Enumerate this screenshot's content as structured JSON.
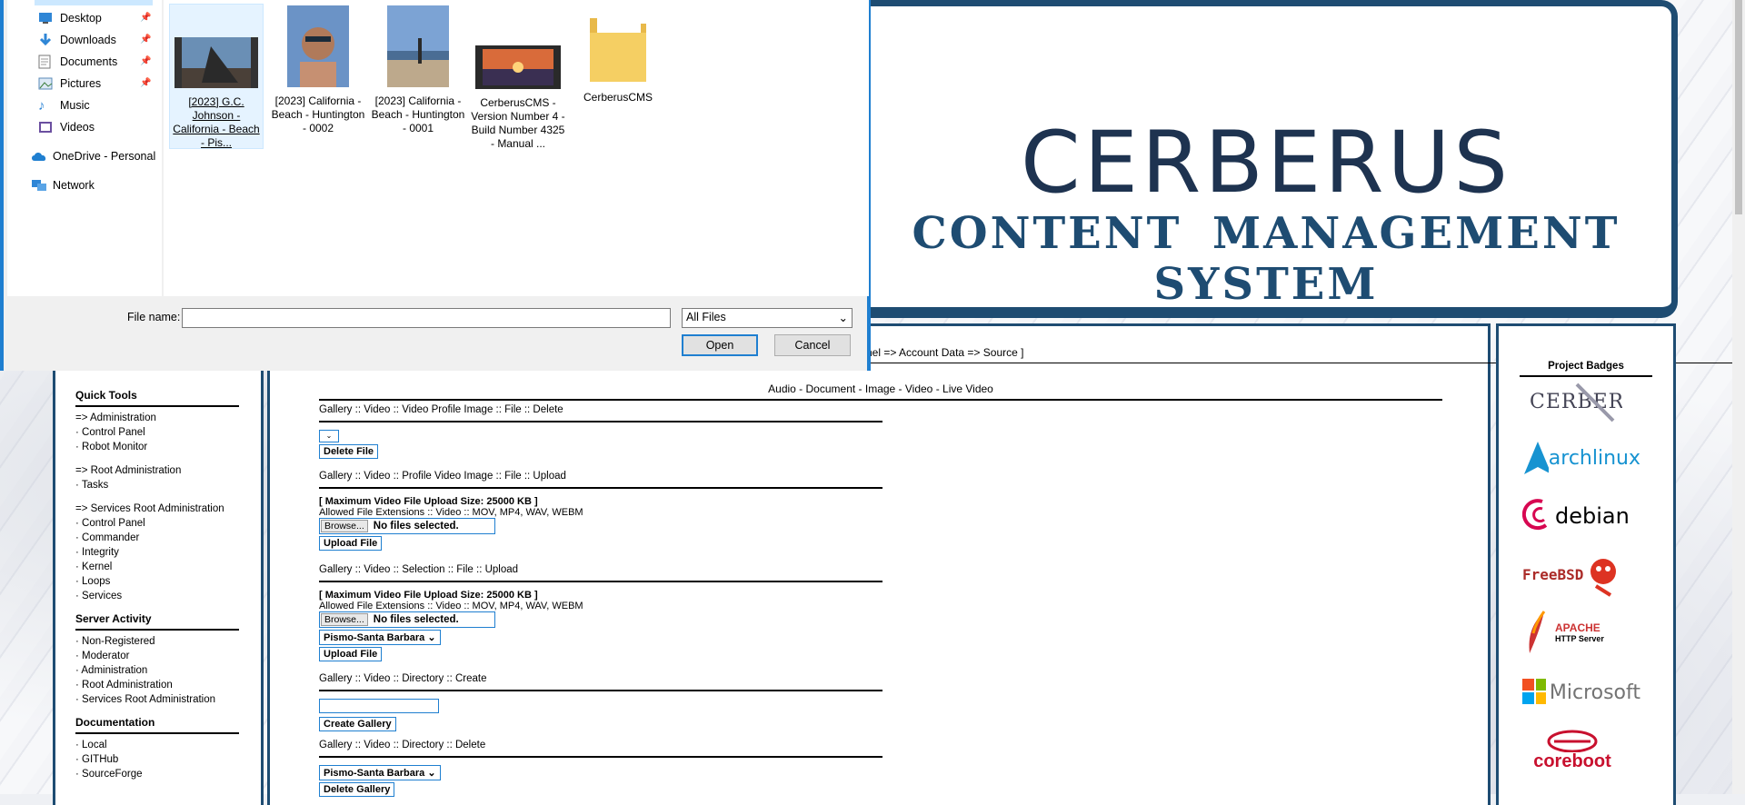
{
  "banner": {
    "title": "CERBERUS",
    "subtitle": "CONTENT MANAGEMENT SYSTEM"
  },
  "left_nav": {
    "quick_tools": "Quick Tools",
    "admin": [
      "=> Administration",
      "· Control Panel",
      "· Robot Monitor"
    ],
    "root_admin": [
      "=> Root Administration",
      "· Tasks"
    ],
    "services_root": [
      "=> Services Root Administration",
      "· Control Panel",
      "· Commander",
      "· Integrity",
      "· Kernel",
      "· Loops",
      "· Services"
    ],
    "server_activity": "Server Activity",
    "activity": [
      "· Non-Registered",
      "· Moderator",
      "· Administration",
      "· Root Administration",
      "· Services Root Administration"
    ],
    "documentation": "Documentation",
    "docs": [
      "· Local",
      "· GITHub",
      "· SourceForge"
    ]
  },
  "main": {
    "breadcrumb": "nel => Account Data => Source ]",
    "media_nav": "Audio - Document - Image - Video - Live Video",
    "sec_delete_file": {
      "title": "Gallery :: Video :: Video Profile Image :: File :: Delete",
      "button": "Delete File"
    },
    "sec_upload_profile": {
      "title": "Gallery :: Video :: Profile Video Image :: File :: Upload",
      "max": "[ Maximum Video File Upload Size: 25000 KB ]",
      "ext": "Allowed File Extensions :: Video :: MOV, MP4, WAV, WEBM",
      "browse": "Browse...",
      "nofile": "No files selected.",
      "button": "Upload File"
    },
    "sec_upload_selection": {
      "title": "Gallery :: Video :: Selection :: File :: Upload",
      "max": "[ Maximum Video File Upload Size: 25000 KB ]",
      "ext": "Allowed File Extensions :: Video :: MOV, MP4, WAV, WEBM",
      "browse": "Browse...",
      "nofile": "No files selected.",
      "gallery": "Pismo-Santa Barbara",
      "button": "Upload File"
    },
    "sec_dir_create": {
      "title": "Gallery :: Video :: Directory :: Create",
      "button": "Create Gallery"
    },
    "sec_dir_delete": {
      "title": "Gallery :: Video :: Directory :: Delete",
      "gallery": "Pismo-Santa Barbara",
      "button": "Delete Gallery"
    }
  },
  "badges": {
    "title": "Project Badges",
    "archlinux": "archlinux",
    "debian": "debian",
    "freebsd": "FreeBSD",
    "apache": "APACHE",
    "apache_sub": "HTTP Server",
    "microsoft": "Microsoft",
    "coreboot": "coreboot"
  },
  "dialog": {
    "nav": [
      {
        "label": "Desktop",
        "icon": "desktop-icon"
      },
      {
        "label": "Downloads",
        "icon": "download-arrow-icon"
      },
      {
        "label": "Documents",
        "icon": "document-icon"
      },
      {
        "label": "Pictures",
        "icon": "pictures-icon"
      },
      {
        "label": "Music",
        "icon": "music-note-icon"
      },
      {
        "label": "Videos",
        "icon": "video-icon"
      },
      {
        "label": "OneDrive - Personal",
        "icon": "cloud-icon"
      },
      {
        "label": "Network",
        "icon": "network-icon"
      }
    ],
    "files": [
      {
        "name": "[2023] G.C. Johnson - California - Beach - Pis..."
      },
      {
        "name": "[2023] California - Beach - Huntington - 0002"
      },
      {
        "name": "[2023] California - Beach - Huntington - 0001"
      },
      {
        "name": "CerberusCMS - Version Number 4 - Build Number 4325 - Manual ..."
      },
      {
        "name": "CerberusCMS"
      }
    ],
    "file_name_label": "File name:",
    "file_name_value": "",
    "file_type": "All Files",
    "open": "Open",
    "cancel": "Cancel"
  }
}
